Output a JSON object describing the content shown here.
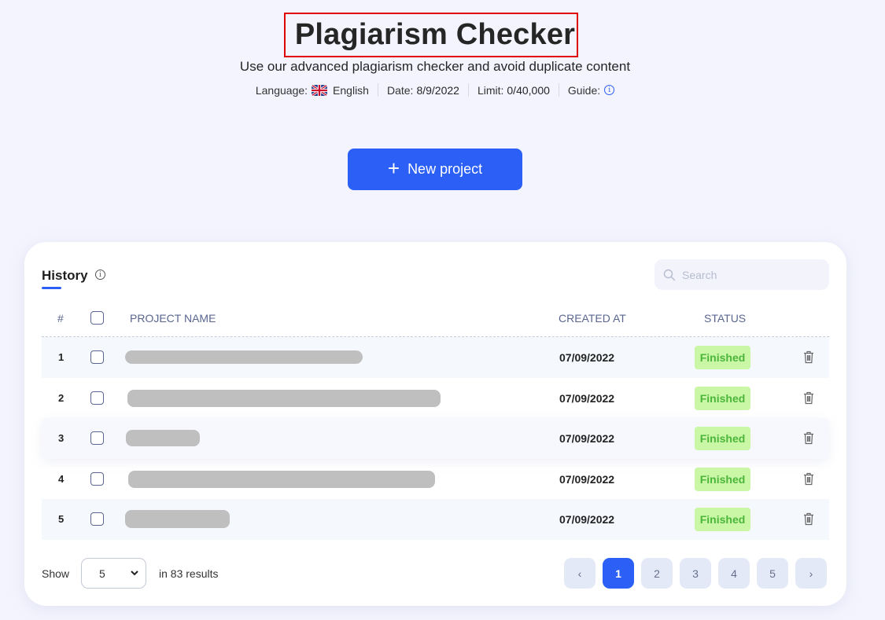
{
  "header": {
    "title": "Plagiarism Checker",
    "subtitle": "Use our advanced plagiarism checker and avoid duplicate content",
    "meta": {
      "language_label": "Language:",
      "language_value": "English",
      "language_flag": "uk-flag-icon",
      "date_label": "Date:",
      "date_value": "8/9/2022",
      "limit_label": "Limit:",
      "limit_value": "0/40,000",
      "guide_label": "Guide:",
      "guide_icon": "info-icon"
    }
  },
  "actions": {
    "new_project_label": "New project",
    "new_project_icon": "plus-icon"
  },
  "history": {
    "title": "History",
    "search_placeholder": "Search",
    "columns": {
      "index": "#",
      "project_name": "PROJECT NAME",
      "created_at": "CREATED AT",
      "status": "STATUS"
    },
    "rows": [
      {
        "index": "1",
        "project_name": "[redacted]",
        "created_at": "07/09/2022",
        "status": "Finished"
      },
      {
        "index": "2",
        "project_name": "[redacted]",
        "created_at": "07/09/2022",
        "status": "Finished"
      },
      {
        "index": "3",
        "project_name": "[redacted]",
        "created_at": "07/09/2022",
        "status": "Finished"
      },
      {
        "index": "4",
        "project_name": "[redacted]",
        "created_at": "07/09/2022",
        "status": "Finished"
      },
      {
        "index": "5",
        "project_name": "[redacted]",
        "created_at": "07/09/2022",
        "status": "Finished"
      }
    ],
    "footer": {
      "show_label": "Show",
      "page_size": "5",
      "results_text": "in 83 results"
    },
    "pagination": {
      "prev": "‹",
      "pages": [
        "1",
        "2",
        "3",
        "4",
        "5"
      ],
      "current": "1",
      "next": "›"
    }
  },
  "colors": {
    "accent": "#2b5ff6",
    "status_finished_bg": "#c9f7a6",
    "status_finished_text": "#4bb63a",
    "title_highlight_border": "#e00000"
  }
}
